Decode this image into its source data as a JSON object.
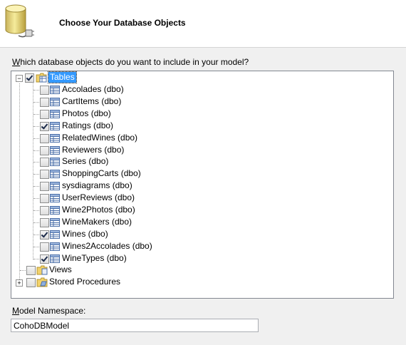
{
  "header": {
    "title": "Choose Your Database Objects",
    "icon": "database-connect-icon"
  },
  "prompt": {
    "underline_char": "W",
    "rest": "hich database objects do you want to include in your model?"
  },
  "tree": {
    "tables": {
      "label": "Tables",
      "checked": true,
      "expanded": true,
      "items": [
        {
          "label": "Accolades (dbo)",
          "checked": false
        },
        {
          "label": "CartItems (dbo)",
          "checked": false
        },
        {
          "label": "Photos (dbo)",
          "checked": false
        },
        {
          "label": "Ratings (dbo)",
          "checked": true
        },
        {
          "label": "RelatedWines (dbo)",
          "checked": false
        },
        {
          "label": "Reviewers (dbo)",
          "checked": false
        },
        {
          "label": "Series (dbo)",
          "checked": false
        },
        {
          "label": "ShoppingCarts (dbo)",
          "checked": false
        },
        {
          "label": "sysdiagrams (dbo)",
          "checked": false
        },
        {
          "label": "UserReviews (dbo)",
          "checked": false
        },
        {
          "label": "Wine2Photos (dbo)",
          "checked": false
        },
        {
          "label": "WineMakers (dbo)",
          "checked": false
        },
        {
          "label": "Wines (dbo)",
          "checked": true
        },
        {
          "label": "Wines2Accolades (dbo)",
          "checked": false
        },
        {
          "label": "WineTypes (dbo)",
          "checked": true
        }
      ]
    },
    "views": {
      "label": "Views",
      "checked": false
    },
    "stored_procedures": {
      "label": "Stored Procedures",
      "checked": false,
      "expanded": false
    }
  },
  "namespace": {
    "underline_char": "M",
    "rest": "odel Namespace:",
    "value": "CohoDBModel"
  },
  "colors": {
    "selection": "#3399ff",
    "window_bg": "#f0f0f0"
  }
}
